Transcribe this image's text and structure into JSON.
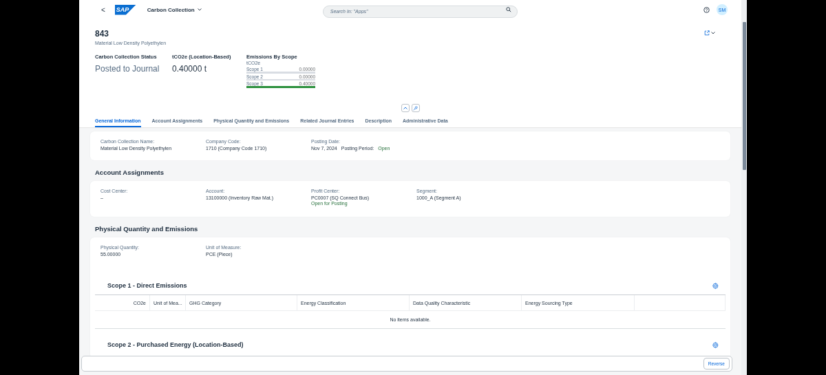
{
  "shell": {
    "back": "<",
    "logo": "SAP",
    "app_title": "Carbon Collection",
    "search": {
      "placeholder": "Search In: \"Apps\""
    },
    "avatar": "SM"
  },
  "header": {
    "title": "843",
    "subtitle": "Material Low Density Polyethylen",
    "kpis": [
      {
        "label": "Carbon Collection Status",
        "value": "Posted to Journal"
      },
      {
        "label": "tCO2e (Location-Based)",
        "value": "0.40000 t"
      }
    ],
    "emissions": {
      "title": "Emissions By Scope",
      "unit": "tCO2e",
      "items": [
        {
          "label": "Scope 1",
          "value": "0.00000",
          "level": 0
        },
        {
          "label": "Scope 2",
          "value": "0.00000",
          "level": 0
        },
        {
          "label": "Scope 3",
          "value": "0.40000",
          "level": 1
        }
      ]
    }
  },
  "tabs": [
    {
      "label": "General Information",
      "selected": true
    },
    {
      "label": "Account Assignments",
      "selected": false
    },
    {
      "label": "Physical Quantity and Emissions",
      "selected": false
    },
    {
      "label": "Related Journal Entries",
      "selected": false
    },
    {
      "label": "Description",
      "selected": false
    },
    {
      "label": "Administrative Data",
      "selected": false
    }
  ],
  "sections": [
    {
      "fields": [
        {
          "label": "Carbon Collection Name:",
          "value": "Material Low Density Polyethylen"
        },
        {
          "label": "Company Code:",
          "value": "1710 (Company Code 1710)"
        },
        {
          "label": "Posting Date:",
          "value": "Nov 7, 2024",
          "extra_label": "Posting Period:",
          "extra_value": "Open"
        }
      ]
    },
    {
      "title": "Account Assignments",
      "fields": [
        {
          "label": "Cost Center:",
          "value": "–"
        },
        {
          "label": "Account:",
          "value": "13100000 (Inventory Raw Mat.)"
        },
        {
          "label": "Profit Center:",
          "value": "PC0007 (SQ Connect Bus)",
          "status": "Open for Posting"
        },
        {
          "label": "Segment:",
          "value": "1000_A (Segment A)"
        }
      ]
    },
    {
      "title": "Physical Quantity and Emissions",
      "fields": [
        {
          "label": "Physical Quantity:",
          "value": "55.00000"
        },
        {
          "label": "Unit of Measure:",
          "value": "PCE (Piece)"
        }
      ],
      "tables": [
        {
          "title": "Scope 1 - Direct Emissions",
          "columns": [
            "CO2e",
            "Unit of Mea...",
            "GHG Category",
            "Energy Classification",
            "Data Quality Characteristic",
            "Energy Sourcing Type"
          ],
          "empty_text": "No items available."
        },
        {
          "title": "Scope 2 - Purchased Energy (Location-Based)"
        }
      ]
    }
  ],
  "footer": {
    "button": "Reverse"
  }
}
